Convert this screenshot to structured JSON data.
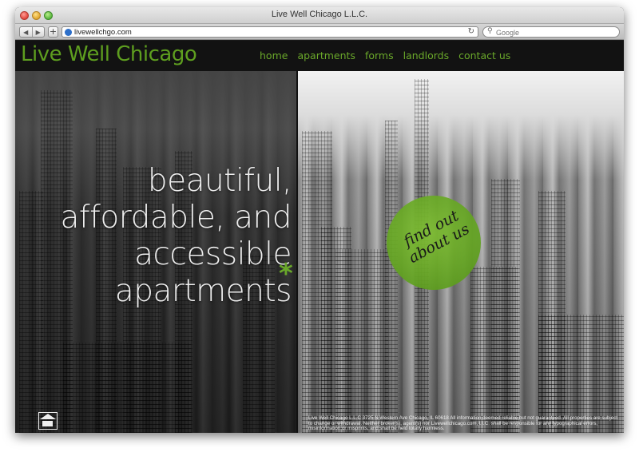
{
  "window": {
    "title": "Live Well Chicago L.L.C."
  },
  "browser": {
    "back_label": "◀",
    "forward_label": "▶",
    "add_label": "+",
    "url": "livewellchgo.com",
    "reload_label": "↻",
    "search_placeholder": "Google"
  },
  "site": {
    "logo": "Live Well Chicago",
    "nav": [
      "home",
      "apartments",
      "forms",
      "landlords",
      "contact us"
    ],
    "tagline": [
      "beautiful,",
      "affordable, and",
      "accessible",
      "apartments"
    ],
    "asterisk": "*",
    "cta": "find out about us",
    "footer": "Live Well Chicago L.L.C 3725 N Western Ave Chicago, IL 60618 All information deemed reliable but not guaranteed. All properties are subject to change or withdrawal. Neither broker(s), agent(s) nor Livewellchicago.com, LLC. shall be responsible for any typographical errors, misinformation or misprints, and shall be held totally harmless."
  },
  "colors": {
    "brand_green": "#6aa82a",
    "header_bg": "#121212"
  },
  "icons": [
    "favicon-icon",
    "search-icon",
    "reload-icon",
    "equal-housing-icon"
  ]
}
